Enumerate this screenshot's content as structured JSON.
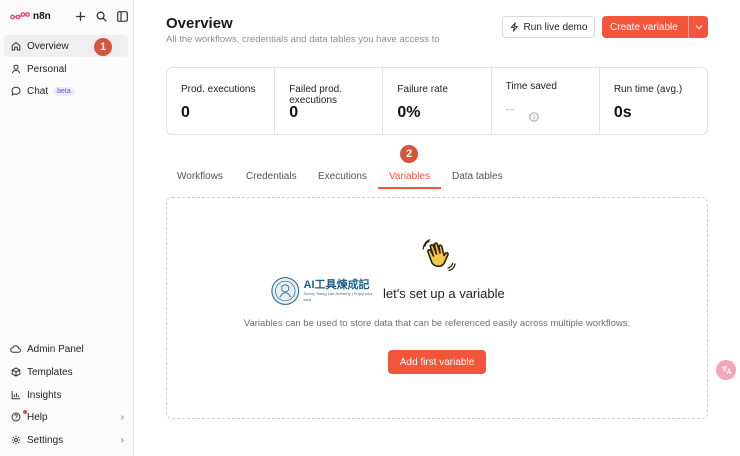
{
  "app": {
    "logo_text": "n8n"
  },
  "sidebar": {
    "top_actions": [
      {
        "name": "add",
        "icon": "plus-icon"
      },
      {
        "name": "search",
        "icon": "search-icon"
      },
      {
        "name": "toggle",
        "icon": "sidebar-toggle-icon"
      }
    ],
    "items": [
      {
        "label": "Overview",
        "icon": "home-icon",
        "active": true
      },
      {
        "label": "Personal",
        "icon": "user-icon"
      },
      {
        "label": "Chat",
        "icon": "chat-bubble-icon",
        "badge": "beta"
      }
    ],
    "bottom_items": [
      {
        "label": "Admin Panel",
        "icon": "cloud-icon"
      },
      {
        "label": "Templates",
        "icon": "box-icon"
      },
      {
        "label": "Insights",
        "icon": "bar-chart-icon"
      },
      {
        "label": "Help",
        "icon": "help-circle-icon"
      },
      {
        "label": "Settings",
        "icon": "gear-icon"
      }
    ]
  },
  "markers": {
    "one": "1",
    "two": "2"
  },
  "header": {
    "title": "Overview",
    "subtitle": "All the workflows, credentials and data tables you have access to",
    "run_demo_label": "Run live demo",
    "create_label": "Create variable"
  },
  "stats": [
    {
      "label": "Prod. executions",
      "value": "0"
    },
    {
      "label": "Failed prod. executions",
      "value": "0"
    },
    {
      "label": "Failure rate",
      "value": "0%"
    },
    {
      "label": "Time saved",
      "value": "--"
    },
    {
      "label": "Run time (avg.)",
      "value": "0s"
    }
  ],
  "tabs": [
    {
      "label": "Workflows"
    },
    {
      "label": "Credentials"
    },
    {
      "label": "Executions"
    },
    {
      "label": "Variables",
      "active": true
    },
    {
      "label": "Data tables"
    }
  ],
  "empty_state": {
    "emoji": "👋",
    "title": "let's set up a variable",
    "description": "Variables can be used to store data that can be referenced easily across multiple workflows.",
    "button_label": "Add first variable"
  },
  "watermark": {
    "title": "AI工具煉成記",
    "subtitle": "Sunny Tseng Lab Alchemy | Enjoy your idea"
  },
  "colors": {
    "accent": "#f2553a",
    "marker": "#d4543c",
    "beta_text": "#5a57d6"
  }
}
